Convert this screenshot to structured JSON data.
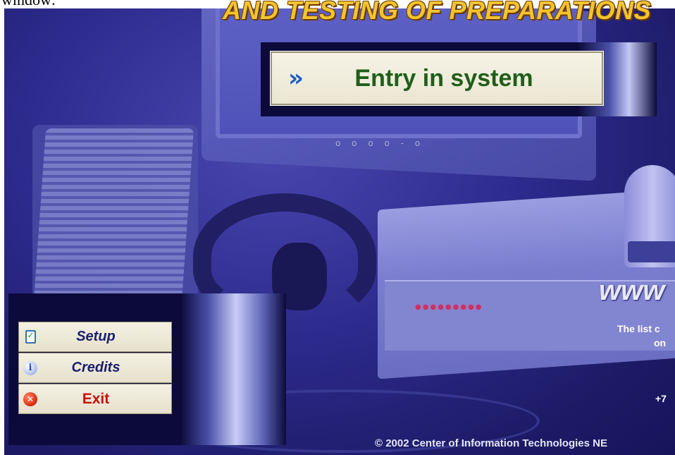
{
  "top_strip": {
    "text": "window:"
  },
  "header": {
    "title": "AND TESTING OF PREPARATIONS"
  },
  "entry": {
    "chevron": "»",
    "label": "Entry in system"
  },
  "menu": {
    "items": [
      {
        "label": "Setup",
        "icon": "checklist-icon"
      },
      {
        "label": "Credits",
        "icon": "info-icon"
      },
      {
        "label": "Exit",
        "icon": "close-circle-icon"
      }
    ]
  },
  "background": {
    "monitor_buttons": "o o o o - o",
    "device_leds": "●●●●●●●●●"
  },
  "info": {
    "www": "www",
    "list_line": "The list c",
    "on_line": "on",
    "phone": "+7"
  },
  "footer": {
    "copyright": "© 2002 Center of Information Technologies NE"
  },
  "colors": {
    "title": "#f4c430",
    "entry_text": "#1f5e1a",
    "menu_text": "#1a1e6e",
    "exit_text": "#c8100a",
    "panel": "#0b0a3a"
  }
}
